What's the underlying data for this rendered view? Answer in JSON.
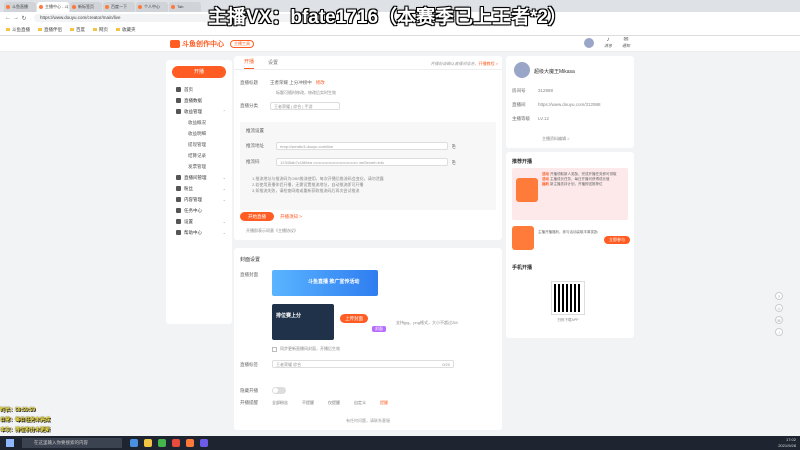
{
  "overlay": {
    "title": "主播VX：bfate1716（本赛季已上王者*2）",
    "left_lines": [
      "时长：59:59:59",
      "日常：每日任务未完成",
      "本次：排位积分未更新"
    ]
  },
  "browser": {
    "tabs": [
      "斗鱼直播",
      "主播中心 - 斗鱼",
      "新标签页",
      "百度一下",
      "个人中心",
      "Tab"
    ],
    "address": "https://www.douyu.com/creator/main/live",
    "bookmarks": [
      "斗鱼直播",
      "直播伴侣",
      "百度",
      "网页",
      "收藏夹"
    ]
  },
  "site": {
    "logo_text": "斗鱼创作中心",
    "logo_pill": "主播工具",
    "header_icons": [
      {
        "glyph": "♪",
        "label": "消息"
      },
      {
        "glyph": "✉",
        "label": "通知"
      }
    ]
  },
  "sidebar": {
    "live_button": "开播",
    "items": [
      {
        "label": "首页",
        "chev": ""
      },
      {
        "label": "直播数据",
        "chev": ""
      },
      {
        "label": "收益管理",
        "chev": "⌃"
      },
      {
        "label": "直播间管理",
        "chev": "⌄"
      },
      {
        "label": "粉丝",
        "chev": "⌄"
      },
      {
        "label": "内容管理",
        "chev": "⌄"
      },
      {
        "label": "任务中心",
        "chev": ""
      },
      {
        "label": "设置",
        "chev": "⌄"
      },
      {
        "label": "帮助中心",
        "chev": "⌄"
      }
    ],
    "subitems": [
      "收益概况",
      "收益明细",
      "提现管理",
      "结算记录",
      "发票管理"
    ]
  },
  "live_settings": {
    "tabs": [
      "开播",
      "设置"
    ],
    "top_right_text": "开播前请确认直播间信息，",
    "top_right_link": "开播教程 >",
    "room_title_label": "直播标题",
    "room_title_value": "王者荣耀 上分冲榜中",
    "room_title_hint": "修改",
    "room_title_note": "标题可随时修改，修改后实时生效",
    "category_label": "直播分类",
    "category_value": "王者荣耀 | 综合 | 手游",
    "panel_title": "推流设置",
    "server_label": "推流地址",
    "server_value": "rtmp://sendtc3.douyu.com/live",
    "key_label": "推流码",
    "key_value": "12345ab7c1f86ea  ••••••••••••••••••••••••••••••••  wsSecret=e4c",
    "notes": [
      "1.推流地址与推流码为OBS推流使用，每次开播后推流码会变化，请勿泄露",
      "2.若使用直播伴侣开播，无需设置推流地址，自动推流即可开播",
      "3.如推流失败，请检查网络或重新获取推流码后再次尝试推流"
    ],
    "start_button": "开始直播",
    "start_link": "开播须知 >",
    "agree_text": "开播即表示同意《主播协议》"
  },
  "cover": {
    "section_title": "封面设置",
    "cover_label": "直播封面",
    "banner_text": "斗鱼直播 推广宣传活动",
    "thumb_text": "排位赛上分",
    "upload_button": "上传封面",
    "upload_note": "支持jpg、png格式，大小不超过2M",
    "tag_badge": "封面",
    "checkbox_text": "同步更新直播间封面，开播后生效",
    "tag_label": "直播标签",
    "tag_value": "王者荣耀 综合 ",
    "tag_count": "0/20",
    "switch_label": "隐藏开播",
    "options_label": "开播提醒",
    "options": [
      "全部粉丝",
      "不提醒",
      "仅提醒",
      "自定义",
      "提醒"
    ],
    "bottom_text": "有任何问题，请联系客服"
  },
  "profile": {
    "name": "超级大魔王Mikasa",
    "rows": [
      {
        "k": "房间号",
        "v": "312988"
      },
      {
        "k": "直播间",
        "v": "https://www.douyu.com/312988"
      },
      {
        "k": "主播等级",
        "v": "LV.12"
      }
    ],
    "link": "主播资料编辑 >"
  },
  "recommend": {
    "title": "推荐开播",
    "items": [
      {
        "tag": "活动",
        "text": "开播领取新人奖励，完成开播任务即可领取"
      },
      {
        "tag": "活动",
        "text": "主播成长任务，每日开播可获得成长值"
      },
      {
        "tag": "福利",
        "text": "新主播扶持计划，开播即送推荐位"
      }
    ],
    "promo_text": "主播开播福利，参与活动赢取丰厚奖励",
    "promo_button": "立即参与",
    "app_title": "手机开播",
    "qr_caption": "扫码下载APP"
  },
  "taskbar": {
    "search": "在这里输入你要搜索的内容",
    "time": "17:02",
    "date": "2021/9/28"
  },
  "colors": {
    "accent": "#ff5d23",
    "bg": "#f2f3f5"
  }
}
